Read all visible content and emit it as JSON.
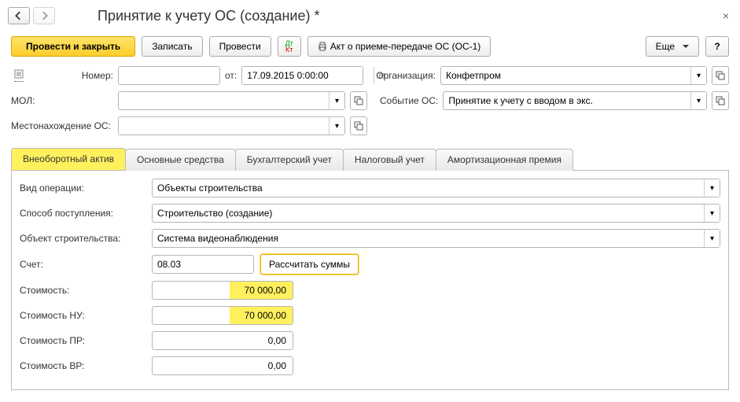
{
  "header": {
    "title": "Принятие к учету ОС (создание) *"
  },
  "toolbar": {
    "post_close": "Провести и закрыть",
    "write": "Записать",
    "post": "Провести",
    "print_report": "Акт о приеме-передаче ОС (ОС-1)",
    "more": "Еще",
    "help": "?"
  },
  "fields": {
    "number_label": "Номер:",
    "number": "",
    "from_label": "от:",
    "date": "17.09.2015 0:00:00",
    "org_label": "Организация:",
    "org": "Конфетпром",
    "mol_label": "МОЛ:",
    "mol": "",
    "event_label": "Событие ОС:",
    "event": "Принятие к учету с вводом в экс.",
    "location_label": "Местонахождение ОС:",
    "location": ""
  },
  "tabs": [
    "Внеоборотный актив",
    "Основные средства",
    "Бухгалтерский учет",
    "Налоговый учет",
    "Амортизационная премия"
  ],
  "tabActive": 0,
  "tabContent": {
    "op_type_label": "Вид операции:",
    "op_type": "Объекты строительства",
    "receipt_label": "Способ поступления:",
    "receipt": "Строительство (создание)",
    "object_label": "Объект строительства:",
    "object": "Система видеонаблюдения",
    "account_label": "Счет:",
    "account": "08.03",
    "calc_btn": "Рассчитать суммы",
    "cost_label": "Стоимость:",
    "cost": "70 000,00",
    "cost_nu_label": "Стоимость НУ:",
    "cost_nu": "70 000,00",
    "cost_pr_label": "Стоимость ПР:",
    "cost_pr": "0,00",
    "cost_vr_label": "Стоимость ВР:",
    "cost_vr": "0,00"
  }
}
